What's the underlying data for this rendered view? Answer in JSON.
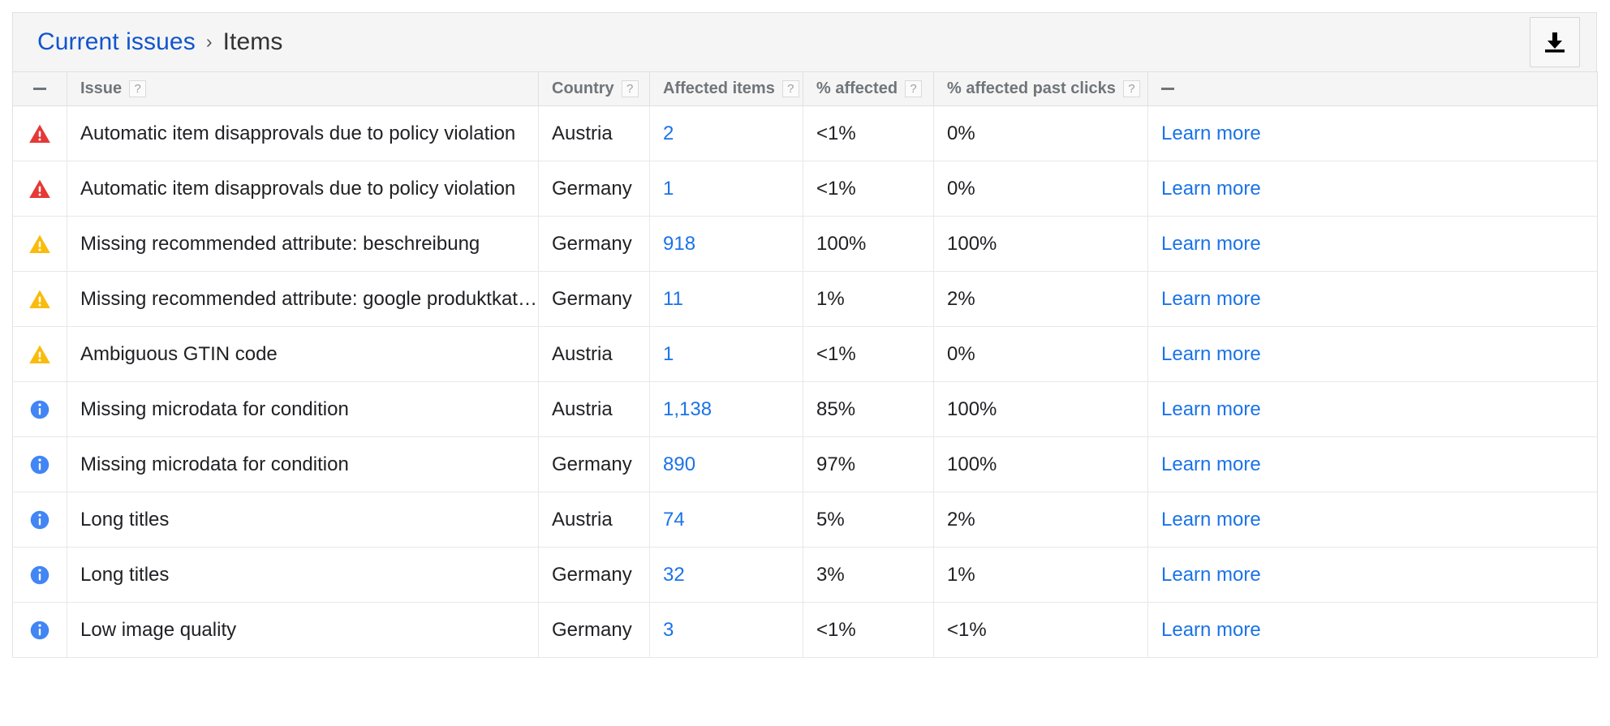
{
  "header": {
    "breadcrumb_root": "Current issues",
    "breadcrumb_separator": "›",
    "breadcrumb_current": "Items",
    "download_icon": "download-icon",
    "download_tooltip": "Download"
  },
  "table": {
    "columns": [
      {
        "key": "severity",
        "label": "–",
        "help": false,
        "type": "dash"
      },
      {
        "key": "issue",
        "label": "Issue",
        "help": true,
        "help_glyph": "?"
      },
      {
        "key": "country",
        "label": "Country",
        "help": true,
        "help_glyph": "?"
      },
      {
        "key": "affected",
        "label": "Affected items",
        "help": true,
        "help_glyph": "?"
      },
      {
        "key": "pct",
        "label": "% affected",
        "help": true,
        "help_glyph": "?"
      },
      {
        "key": "pctpast",
        "label": "% affected past clicks",
        "help": true,
        "help_glyph": "?"
      },
      {
        "key": "learn",
        "label": "–",
        "help": false,
        "type": "dash"
      }
    ],
    "rows": [
      {
        "severity": "error",
        "severity_icon": "error-triangle-icon",
        "issue": "Automatic item disapprovals due to policy violation",
        "country": "Austria",
        "affected": "2",
        "pct": "<1%",
        "pctpast": "0%",
        "learn": "Learn more"
      },
      {
        "severity": "error",
        "severity_icon": "error-triangle-icon",
        "issue": "Automatic item disapprovals due to policy violation",
        "country": "Germany",
        "affected": "1",
        "pct": "<1%",
        "pctpast": "0%",
        "learn": "Learn more"
      },
      {
        "severity": "warning",
        "severity_icon": "warning-triangle-icon",
        "issue": "Missing recommended attribute: beschreibung",
        "country": "Germany",
        "affected": "918",
        "pct": "100%",
        "pctpast": "100%",
        "learn": "Learn more"
      },
      {
        "severity": "warning",
        "severity_icon": "warning-triangle-icon",
        "issue": "Missing recommended attribute: google produktkategorie",
        "country": "Germany",
        "affected": "11",
        "pct": "1%",
        "pctpast": "2%",
        "learn": "Learn more"
      },
      {
        "severity": "warning",
        "severity_icon": "warning-triangle-icon",
        "issue": "Ambiguous GTIN code",
        "country": "Austria",
        "affected": "1",
        "pct": "<1%",
        "pctpast": "0%",
        "learn": "Learn more"
      },
      {
        "severity": "info",
        "severity_icon": "info-circle-icon",
        "issue": "Missing microdata for condition",
        "country": "Austria",
        "affected": "1,138",
        "pct": "85%",
        "pctpast": "100%",
        "learn": "Learn more"
      },
      {
        "severity": "info",
        "severity_icon": "info-circle-icon",
        "issue": "Missing microdata for condition",
        "country": "Germany",
        "affected": "890",
        "pct": "97%",
        "pctpast": "100%",
        "learn": "Learn more"
      },
      {
        "severity": "info",
        "severity_icon": "info-circle-icon",
        "issue": "Long titles",
        "country": "Austria",
        "affected": "74",
        "pct": "5%",
        "pctpast": "2%",
        "learn": "Learn more"
      },
      {
        "severity": "info",
        "severity_icon": "info-circle-icon",
        "issue": "Long titles",
        "country": "Germany",
        "affected": "32",
        "pct": "3%",
        "pctpast": "1%",
        "learn": "Learn more"
      },
      {
        "severity": "info",
        "severity_icon": "info-circle-icon",
        "issue": "Low image quality",
        "country": "Germany",
        "affected": "3",
        "pct": "<1%",
        "pctpast": "<1%",
        "learn": "Learn more"
      }
    ]
  },
  "colors": {
    "link": "#1a73e8",
    "breadcrumb_link": "#1155cc",
    "error": "#e53935",
    "warning": "#f9bc0c",
    "info": "#4285f4",
    "header_bg": "#f5f5f5",
    "border": "#e0e0e0",
    "text": "#202124",
    "muted": "#70757a"
  }
}
